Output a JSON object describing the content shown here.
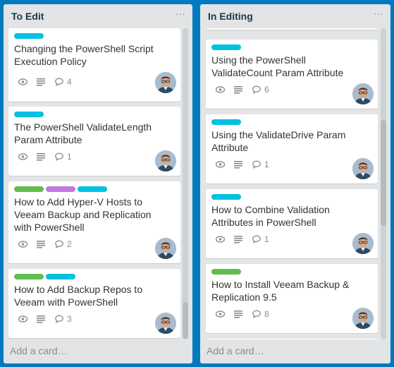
{
  "colors": {
    "board_background": "#0079bf",
    "list_background": "#e2e4e6",
    "label_cyan": "#00c2e0",
    "label_green": "#61bd4f",
    "label_purple": "#c377e0"
  },
  "lists": [
    {
      "title": "To Edit",
      "menu": "···",
      "add_card": "Add a card…",
      "cards": [
        {
          "labels": [
            "cyan"
          ],
          "title": "Changing the PowerShell Script Execution Policy",
          "icons": [
            "eye-icon",
            "description-icon",
            "comment-icon"
          ],
          "comments": "4"
        },
        {
          "labels": [
            "cyan"
          ],
          "title": "The PowerShell ValidateLength Param Attribute",
          "icons": [
            "eye-icon",
            "description-icon",
            "comment-icon"
          ],
          "comments": "1"
        },
        {
          "labels": [
            "green",
            "purple",
            "cyan"
          ],
          "title": "How to Add Hyper-V Hosts to Veeam Backup and Replication with PowerShell",
          "icons": [
            "eye-icon",
            "description-icon",
            "comment-icon"
          ],
          "comments": "2"
        },
        {
          "labels": [
            "green",
            "cyan"
          ],
          "title": "How to Add Backup Repos to Veeam with PowerShell",
          "icons": [
            "eye-icon",
            "description-icon",
            "comment-icon"
          ],
          "comments": "3"
        }
      ]
    },
    {
      "title": "In Editing",
      "menu": "···",
      "add_card": "Add a card…",
      "cards": [
        {
          "labels": [
            "cyan"
          ],
          "title": "Using the PowerShell ValidateCount Param Attribute",
          "icons": [
            "eye-icon",
            "description-icon",
            "comment-icon"
          ],
          "comments": "6"
        },
        {
          "labels": [
            "cyan"
          ],
          "title": "Using the ValidateDrive Param Attribute",
          "icons": [
            "eye-icon",
            "description-icon",
            "comment-icon"
          ],
          "comments": "1"
        },
        {
          "labels": [
            "cyan"
          ],
          "title": "How to Combine Validation Attributes in PowerShell",
          "icons": [
            "eye-icon",
            "description-icon",
            "comment-icon"
          ],
          "comments": "1"
        },
        {
          "labels": [
            "green"
          ],
          "title": "How to Install Veeam Backup & Replication 9.5",
          "icons": [
            "eye-icon",
            "description-icon",
            "comment-icon"
          ],
          "comments": "8"
        }
      ]
    }
  ]
}
